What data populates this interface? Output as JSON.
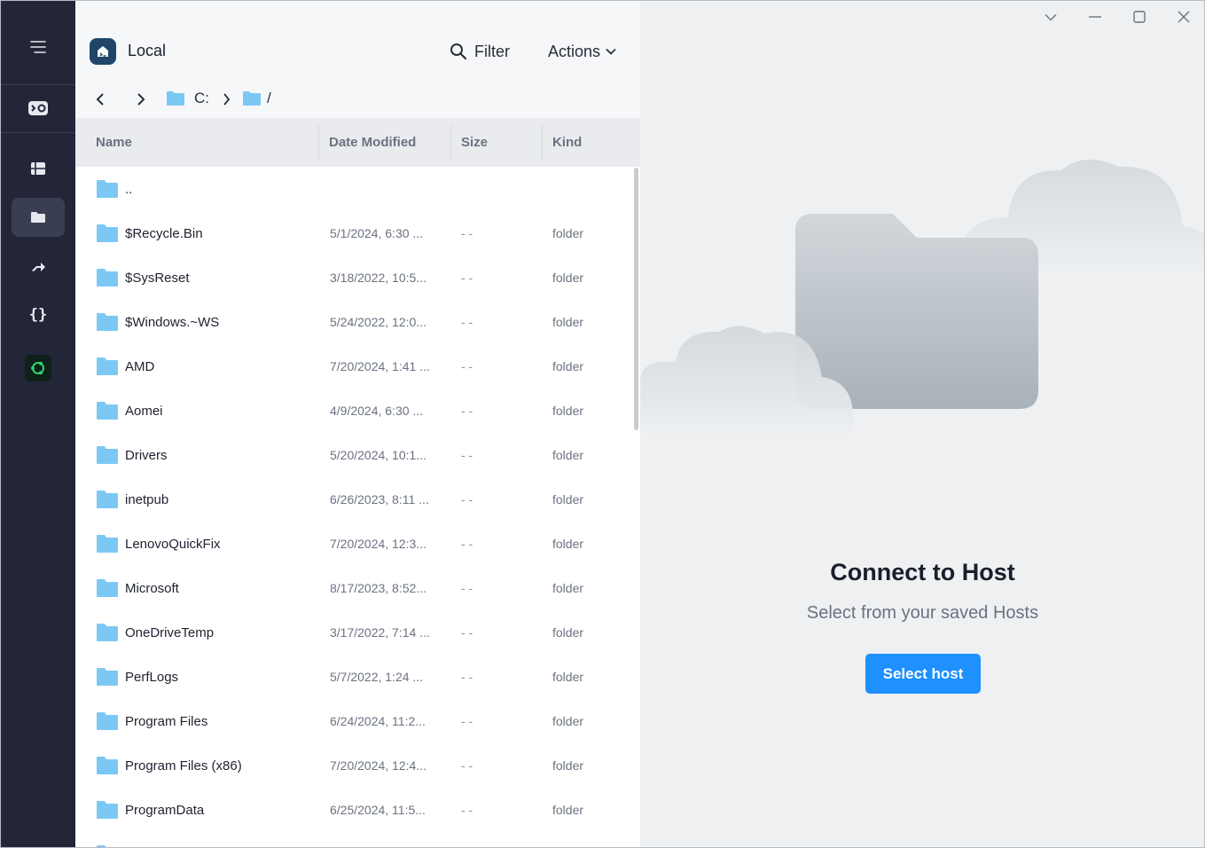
{
  "sidebar": {
    "items": [
      {
        "icon": "menu-icon"
      },
      {
        "icon": "terminal-logo-icon"
      },
      {
        "icon": "hosts-icon"
      },
      {
        "icon": "sftp-folder-icon",
        "active": true
      },
      {
        "icon": "port-forwarding-icon"
      },
      {
        "icon": "snippets-icon"
      },
      {
        "icon": "ubuntu-icon"
      }
    ]
  },
  "header": {
    "local_label": "Local",
    "filter_label": "Filter",
    "actions_label": "Actions",
    "breadcrumb": {
      "drive": "C:",
      "path": "/"
    }
  },
  "columns": {
    "name": "Name",
    "date": "Date Modified",
    "size": "Size",
    "kind": "Kind"
  },
  "files": [
    {
      "name": "..",
      "date": "",
      "size": "",
      "kind": ""
    },
    {
      "name": "$Recycle.Bin",
      "date": "5/1/2024, 6:30 ...",
      "size": "- -",
      "kind": "folder"
    },
    {
      "name": "$SysReset",
      "date": "3/18/2022, 10:5...",
      "size": "- -",
      "kind": "folder"
    },
    {
      "name": "$Windows.~WS",
      "date": "5/24/2022, 12:0...",
      "size": "- -",
      "kind": "folder"
    },
    {
      "name": "AMD",
      "date": "7/20/2024, 1:41 ...",
      "size": "- -",
      "kind": "folder"
    },
    {
      "name": "Aomei",
      "date": "4/9/2024, 6:30 ...",
      "size": "- -",
      "kind": "folder"
    },
    {
      "name": "Drivers",
      "date": "5/20/2024, 10:1...",
      "size": "- -",
      "kind": "folder"
    },
    {
      "name": "inetpub",
      "date": "6/26/2023, 8:11 ...",
      "size": "- -",
      "kind": "folder"
    },
    {
      "name": "LenovoQuickFix",
      "date": "7/20/2024, 12:3...",
      "size": "- -",
      "kind": "folder"
    },
    {
      "name": "Microsoft",
      "date": "8/17/2023, 8:52...",
      "size": "- -",
      "kind": "folder"
    },
    {
      "name": "OneDriveTemp",
      "date": "3/17/2022, 7:14 ...",
      "size": "- -",
      "kind": "folder"
    },
    {
      "name": "PerfLogs",
      "date": "5/7/2022, 1:24 ...",
      "size": "- -",
      "kind": "folder"
    },
    {
      "name": "Program Files",
      "date": "6/24/2024, 11:2...",
      "size": "- -",
      "kind": "folder"
    },
    {
      "name": "Program Files (x86)",
      "date": "7/20/2024, 12:4...",
      "size": "- -",
      "kind": "folder"
    },
    {
      "name": "ProgramData",
      "date": "6/25/2024, 11:5...",
      "size": "- -",
      "kind": "folder"
    },
    {
      "name": "",
      "date": "",
      "size": "",
      "kind": ""
    }
  ],
  "right_panel": {
    "title": "Connect to Host",
    "subtitle": "Select from your saved Hosts",
    "button_label": "Select host"
  },
  "window_controls": [
    "chevron-down-icon",
    "minimize-icon",
    "maximize-icon",
    "close-icon"
  ],
  "colors": {
    "sidebar_bg": "#232638",
    "folder_blue": "#7cc8f5",
    "accent": "#1e90ff"
  }
}
